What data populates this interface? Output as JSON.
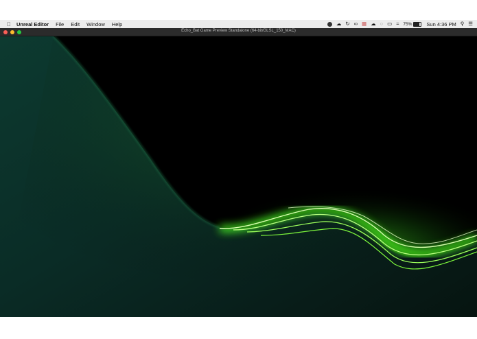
{
  "menubar": {
    "apple_icon": "apple-logo-icon",
    "app_name": "Unreal Editor",
    "menus": [
      "File",
      "Edit",
      "Window",
      "Help"
    ],
    "status_icons": [
      "messages-icon",
      "cloud-icon",
      "sync-icon",
      "glasses-icon",
      "grid-icon",
      "cloud-dark-icon",
      "link-icon",
      "airplay-icon",
      "wifi-icon"
    ],
    "battery_percent": "75%",
    "battery_level": 0.75,
    "clock": "Sun 4:36 PM",
    "search_icon": "search-icon",
    "list_icon": "list-icon"
  },
  "window": {
    "title": "Echo_Bat Game Preview Standalone (64-bit/GLSL_150_MAC)",
    "colors": {
      "close": "#fc5f57",
      "minimize": "#fdbc2e",
      "maximize": "#27c840",
      "glow": "#7dff3a",
      "terrain": "#0b3a2a"
    }
  }
}
